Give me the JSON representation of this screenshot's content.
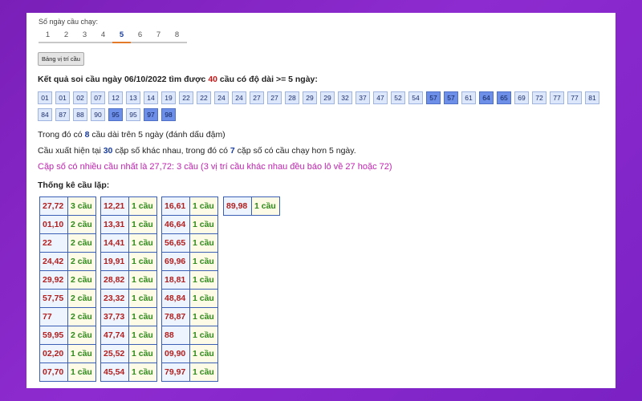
{
  "days": {
    "label": "Số ngày cầu chạy:",
    "options": [
      "1",
      "2",
      "3",
      "4",
      "5",
      "6",
      "7",
      "8"
    ],
    "active": "5"
  },
  "button_label": "Bảng vị trí cầu",
  "result": {
    "prefix": "Kết quả soi cầu ngày 06/10/2022 tìm được ",
    "count": "40",
    "suffix": " cầu có độ dài >= 5 ngày:"
  },
  "numbers": [
    {
      "v": "01",
      "hl": false
    },
    {
      "v": "01",
      "hl": false
    },
    {
      "v": "02",
      "hl": false
    },
    {
      "v": "07",
      "hl": false
    },
    {
      "v": "12",
      "hl": false
    },
    {
      "v": "13",
      "hl": false
    },
    {
      "v": "14",
      "hl": false
    },
    {
      "v": "19",
      "hl": false
    },
    {
      "v": "22",
      "hl": false
    },
    {
      "v": "22",
      "hl": false
    },
    {
      "v": "24",
      "hl": false
    },
    {
      "v": "24",
      "hl": false
    },
    {
      "v": "27",
      "hl": false
    },
    {
      "v": "27",
      "hl": false
    },
    {
      "v": "28",
      "hl": false
    },
    {
      "v": "29",
      "hl": false
    },
    {
      "v": "29",
      "hl": false
    },
    {
      "v": "32",
      "hl": false
    },
    {
      "v": "37",
      "hl": false
    },
    {
      "v": "47",
      "hl": false
    },
    {
      "v": "52",
      "hl": false
    },
    {
      "v": "54",
      "hl": false
    },
    {
      "v": "57",
      "hl": true
    },
    {
      "v": "57",
      "hl": true
    },
    {
      "v": "61",
      "hl": false
    },
    {
      "v": "64",
      "hl": true
    },
    {
      "v": "65",
      "hl": true
    },
    {
      "v": "69",
      "hl": false
    },
    {
      "v": "72",
      "hl": false
    },
    {
      "v": "77",
      "hl": false
    },
    {
      "v": "77",
      "hl": false
    },
    {
      "v": "81",
      "hl": false
    },
    {
      "v": "84",
      "hl": false
    },
    {
      "v": "87",
      "hl": false
    },
    {
      "v": "88",
      "hl": false
    },
    {
      "v": "90",
      "hl": false
    },
    {
      "v": "95",
      "hl": true
    },
    {
      "v": "95",
      "hl": false
    },
    {
      "v": "97",
      "hl": true
    },
    {
      "v": "98",
      "hl": true
    }
  ],
  "summary": {
    "l1_a": "Trong đó có ",
    "l1_n": "8",
    "l1_b": " cầu dài trên 5 ngày (đánh dấu đậm)",
    "l2_a": "Cầu xuất hiện tại ",
    "l2_n1": "30",
    "l2_b": " cặp số khác nhau, trong đó có ",
    "l2_n2": "7",
    "l2_c": " cặp số có cầu chạy hơn 5 ngày.",
    "l3": "Cặp số có nhiều cầu nhất là 27,72: 3 cầu (3 vị trí cầu khác nhau đều báo lô về 27 hoặc 72)"
  },
  "stats_title": "Thống kê cầu lặp:",
  "stats_columns": [
    [
      [
        "27,72",
        "3 cầu"
      ],
      [
        "01,10",
        "2 cầu"
      ],
      [
        "22",
        "2 cầu"
      ],
      [
        "24,42",
        "2 cầu"
      ],
      [
        "29,92",
        "2 cầu"
      ],
      [
        "57,75",
        "2 cầu"
      ],
      [
        "77",
        "2 cầu"
      ],
      [
        "59,95",
        "2 cầu"
      ],
      [
        "02,20",
        "1 cầu"
      ],
      [
        "07,70",
        "1 cầu"
      ]
    ],
    [
      [
        "12,21",
        "1 cầu"
      ],
      [
        "13,31",
        "1 cầu"
      ],
      [
        "14,41",
        "1 cầu"
      ],
      [
        "19,91",
        "1 cầu"
      ],
      [
        "28,82",
        "1 cầu"
      ],
      [
        "23,32",
        "1 cầu"
      ],
      [
        "37,73",
        "1 cầu"
      ],
      [
        "47,74",
        "1 cầu"
      ],
      [
        "25,52",
        "1 cầu"
      ],
      [
        "45,54",
        "1 cầu"
      ]
    ],
    [
      [
        "16,61",
        "1 cầu"
      ],
      [
        "46,64",
        "1 cầu"
      ],
      [
        "56,65",
        "1 cầu"
      ],
      [
        "69,96",
        "1 cầu"
      ],
      [
        "18,81",
        "1 cầu"
      ],
      [
        "48,84",
        "1 cầu"
      ],
      [
        "78,87",
        "1 cầu"
      ],
      [
        "88",
        "1 cầu"
      ],
      [
        "09,90",
        "1 cầu"
      ],
      [
        "79,97",
        "1 cầu"
      ]
    ],
    [
      [
        "89,98",
        "1 cầu"
      ]
    ]
  ]
}
